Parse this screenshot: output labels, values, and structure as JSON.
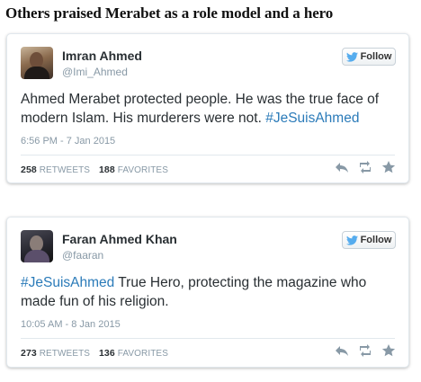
{
  "headline": "Others praised Merabet as a role model and a hero",
  "colors": {
    "link": "#2b7bb9",
    "muted": "#8899a6",
    "text": "#292f33",
    "twitter_blue": "#55acee"
  },
  "tweets": [
    {
      "name": "Imran Ahmed",
      "handle": "@Imi_Ahmed",
      "follow_label": "Follow",
      "text": "Ahmed Merabet protected people. He was the true face of modern Islam. His murderers were not. ",
      "hashtag": "#JeSuisAhmed",
      "timestamp": "6:56 PM - 7 Jan 2015",
      "retweets": "258",
      "retweets_label": "RETWEETS",
      "favorites": "188",
      "favorites_label": "FAVORITES",
      "actions": [
        "reply-icon",
        "retweet-icon",
        "favorite-star-icon"
      ]
    },
    {
      "name": "Faran Ahmed Khan",
      "handle": "@faaran",
      "follow_label": "Follow",
      "hashtag": "#JeSuisAhmed",
      "text": " True Hero, protecting the magazine who made fun of his religion.",
      "timestamp": "10:05 AM - 8 Jan 2015",
      "retweets": "273",
      "retweets_label": "RETWEETS",
      "favorites": "136",
      "favorites_label": "FAVORITES",
      "actions": [
        "reply-icon",
        "retweet-icon",
        "favorite-star-icon"
      ]
    }
  ]
}
